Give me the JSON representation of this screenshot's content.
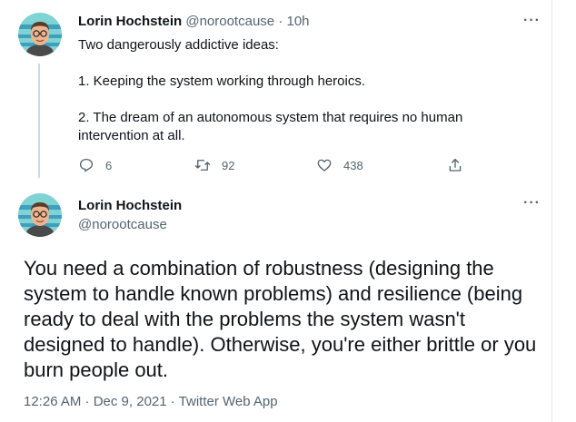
{
  "tweet1": {
    "author_name": "Lorin Hochstein",
    "author_handle": "@norootcause",
    "separator": "·",
    "time": "10h",
    "paragraphs": [
      "Two dangerously addictive ideas:",
      "1. Keeping the system working through heroics.",
      "2. The dream of an autonomous system that requires no human intervention at all."
    ],
    "replies": "6",
    "retweets": "92",
    "likes": "438"
  },
  "tweet2": {
    "author_name": "Lorin Hochstein",
    "author_handle": "@norootcause",
    "text": "You need a combination of robustness (designing the system to handle known problems) and resilience (being ready to deal with the problems the system wasn't designed to handle). Otherwise, you're either brittle or you burn people out.",
    "timestamp": "12:26 AM · Dec 9, 2021 · Twitter Web App"
  },
  "icons": {
    "more": "more-icon",
    "reply": "reply-icon",
    "retweet": "retweet-icon",
    "like": "heart-icon",
    "share": "share-icon"
  },
  "colors": {
    "text_primary": "#0f1419",
    "text_muted": "#536471",
    "thread_line": "#cfd9de"
  }
}
